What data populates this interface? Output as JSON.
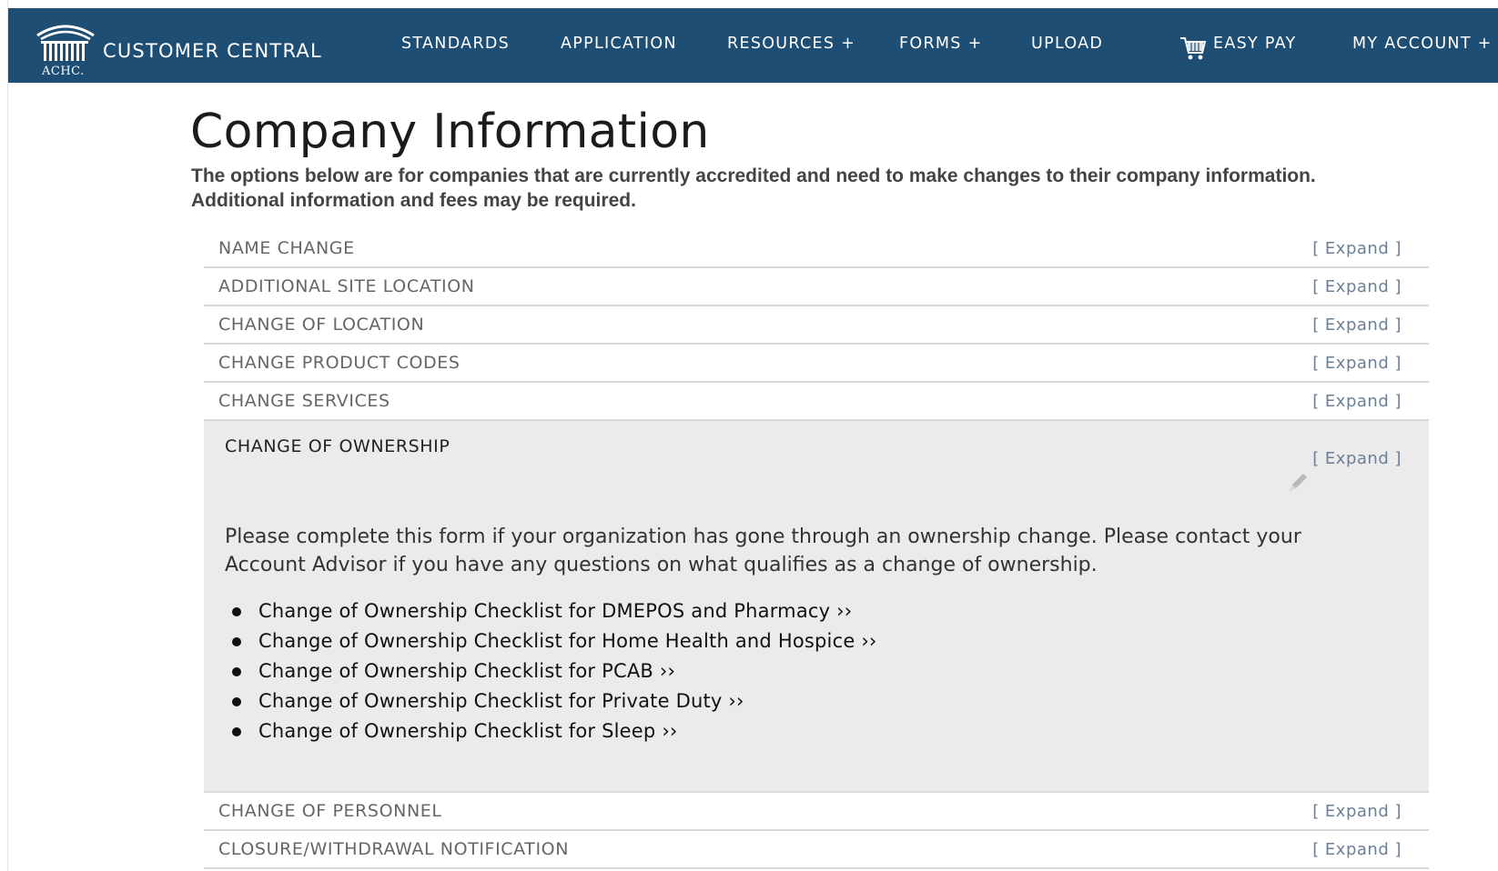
{
  "header": {
    "logo_text": "ACHC.",
    "brand_name": "CUSTOMER CENTRAL",
    "nav": [
      {
        "label": "STANDARDS"
      },
      {
        "label": "APPLICATION"
      },
      {
        "label": "RESOURCES +"
      },
      {
        "label": "FORMS +"
      },
      {
        "label": "UPLOAD"
      },
      {
        "label": "EASY PAY",
        "icon": "cart-icon"
      },
      {
        "label": "MY ACCOUNT +"
      }
    ]
  },
  "main": {
    "title": "Company Information",
    "intro": "The options below are for companies that are currently accredited and need to make changes to their company information. Additional information and fees may be required.",
    "expand_label": "[ Expand ]",
    "sections_before": [
      {
        "title": "NAME CHANGE"
      },
      {
        "title": "ADDITIONAL SITE LOCATION"
      },
      {
        "title": "CHANGE OF LOCATION"
      },
      {
        "title": "CHANGE PRODUCT CODES"
      },
      {
        "title": "CHANGE SERVICES"
      }
    ],
    "open_section": {
      "title": "CHANGE OF OWNERSHIP",
      "icon": "pencil-icon",
      "description": "Please complete this form if your organization has gone through an ownership change. Please contact your Account Advisor if you have any questions on what qualifies as a change of ownership.",
      "links": [
        "Change of Ownership Checklist for DMEPOS and Pharmacy ››",
        "Change of Ownership Checklist for Home Health and Hospice ››",
        "Change of Ownership Checklist for PCAB ››",
        "Change of Ownership Checklist for Private Duty ››",
        "Change of Ownership Checklist for Sleep ››"
      ]
    },
    "sections_after": [
      {
        "title": "CHANGE OF PERSONNEL"
      },
      {
        "title": "CLOSURE/WITHDRAWAL NOTIFICATION"
      }
    ]
  },
  "colors": {
    "navbar": "#1f4e75",
    "expand_link": "#6b7f96",
    "open_panel": "#ebebeb"
  }
}
